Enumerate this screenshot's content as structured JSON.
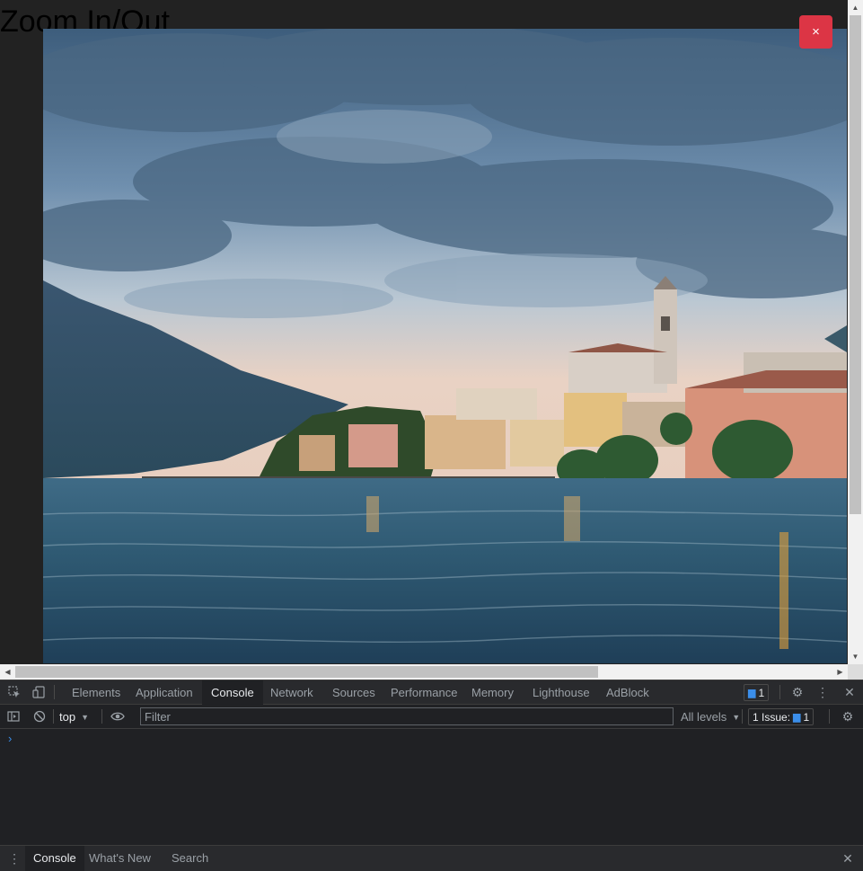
{
  "page": {
    "title": "Zoom In/Out",
    "close_label": "×"
  },
  "image": {
    "description_icon": "lake-town-photo-icon"
  },
  "devtools": {
    "tabs": [
      {
        "label": "Elements"
      },
      {
        "label": "Application"
      },
      {
        "label": "Console"
      },
      {
        "label": "Network"
      },
      {
        "label": "Sources"
      },
      {
        "label": "Performance"
      },
      {
        "label": "Memory"
      },
      {
        "label": "Lighthouse"
      },
      {
        "label": "AdBlock"
      }
    ],
    "active_tab": "Console",
    "messages_badge": "1",
    "toolbar": {
      "context": "top",
      "filter_placeholder": "Filter",
      "levels": "All levels",
      "issues_label": "1 Issue:",
      "issues_count": "1"
    },
    "prompt": "›",
    "drawer_tabs": [
      {
        "label": "Console"
      },
      {
        "label": "What's New"
      },
      {
        "label": "Search"
      }
    ]
  },
  "colors": {
    "close_button": "#dc3545",
    "accent": "#3b8eea"
  }
}
